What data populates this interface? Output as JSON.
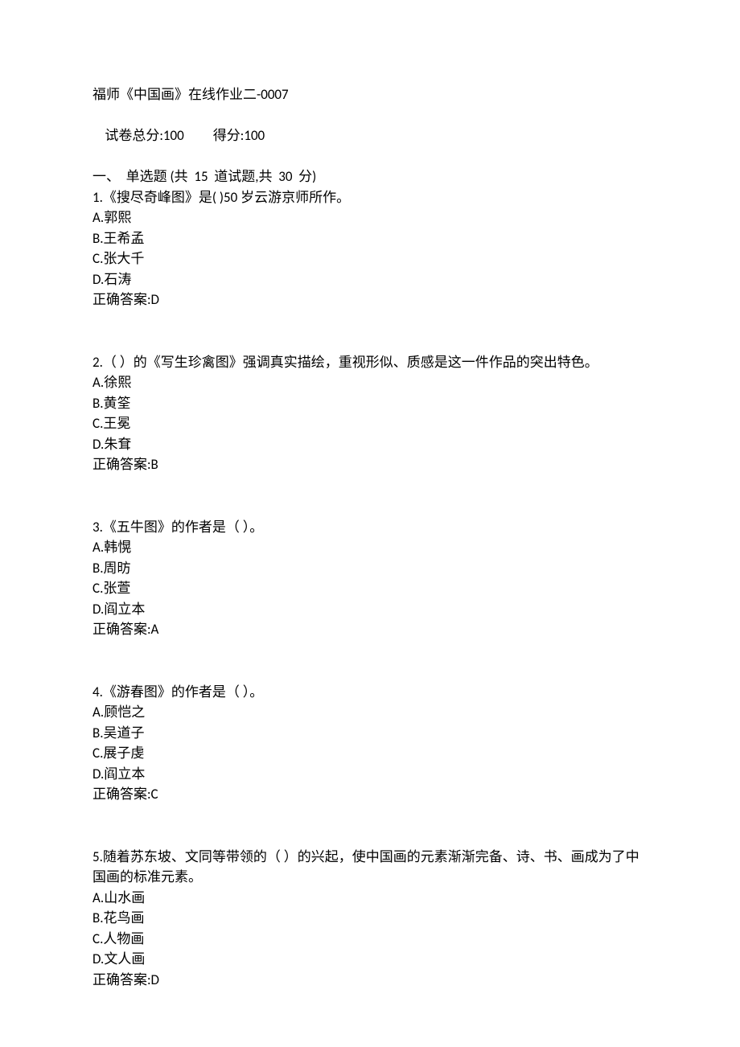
{
  "header": {
    "title": "福师《中国画》在线作业二-0007",
    "total_label": "试卷总分:100",
    "score_label": "得分:100",
    "section_header": "一、  单选题 (共  15  道试题,共  30  分)"
  },
  "questions": [
    {
      "stem": "1.《搜尽奇峰图》是( )50 岁云游京师所作。",
      "options": [
        "A.郭熙",
        "B.王希孟",
        "C.张大千",
        "D.石涛"
      ],
      "answer": "正确答案:D"
    },
    {
      "stem": "2.（ ）的《写生珍禽图》强调真实描绘，重视形似、质感是这一件作品的突出特色。",
      "options": [
        "A.徐熙",
        "B.黄筌",
        "C.王冕",
        "D.朱耷"
      ],
      "answer": "正确答案:B"
    },
    {
      "stem": "3.《五牛图》的作者是（ ）。",
      "options": [
        "A.韩愰",
        "B.周昉",
        "C.张萱",
        "D.阎立本"
      ],
      "answer": "正确答案:A"
    },
    {
      "stem": "4.《游春图》的作者是（ ）。",
      "options": [
        "A.顾恺之",
        "B.吴道子",
        "C.展子虔",
        "D.阎立本"
      ],
      "answer": "正确答案:C"
    },
    {
      "stem": "5.随着苏东坡、文同等带领的（ ）的兴起，使中国画的元素渐渐完备、诗、书、画成为了中国画的标准元素。",
      "options": [
        "A.山水画",
        "B.花鸟画",
        "C.人物画",
        "D.文人画"
      ],
      "answer": "正确答案:D"
    }
  ]
}
